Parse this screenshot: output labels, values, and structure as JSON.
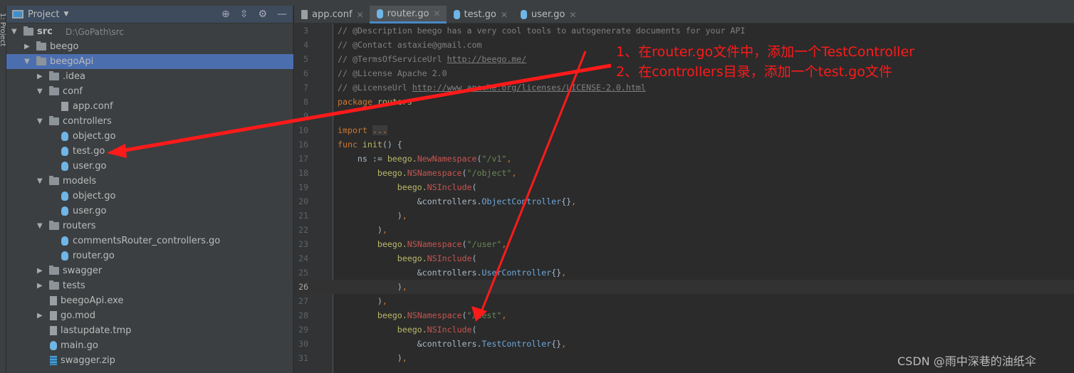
{
  "sidebar_stripe_label": "1: Project",
  "project_panel": {
    "title": "Project",
    "tools": [
      "locate-icon",
      "collapse-icon",
      "gear-icon",
      "minimize-icon"
    ],
    "tree": [
      {
        "label": "src",
        "path": "D:\\GoPath\\src",
        "level": 0,
        "type": "folder",
        "expanded": true
      },
      {
        "label": "beego",
        "level": 1,
        "type": "folder",
        "expanded": false
      },
      {
        "label": "beegoApi",
        "level": 1,
        "type": "folder",
        "expanded": true,
        "selected": true
      },
      {
        "label": ".idea",
        "level": 2,
        "type": "folder",
        "expanded": false
      },
      {
        "label": "conf",
        "level": 2,
        "type": "folder",
        "expanded": true
      },
      {
        "label": "app.conf",
        "level": 3,
        "type": "file"
      },
      {
        "label": "controllers",
        "level": 2,
        "type": "folder",
        "expanded": true
      },
      {
        "label": "object.go",
        "level": 3,
        "type": "go"
      },
      {
        "label": "test.go",
        "level": 3,
        "type": "go"
      },
      {
        "label": "user.go",
        "level": 3,
        "type": "go"
      },
      {
        "label": "models",
        "level": 2,
        "type": "folder",
        "expanded": true
      },
      {
        "label": "object.go",
        "level": 3,
        "type": "go"
      },
      {
        "label": "user.go",
        "level": 3,
        "type": "go"
      },
      {
        "label": "routers",
        "level": 2,
        "type": "folder",
        "expanded": true
      },
      {
        "label": "commentsRouter_controllers.go",
        "level": 3,
        "type": "go"
      },
      {
        "label": "router.go",
        "level": 3,
        "type": "go"
      },
      {
        "label": "swagger",
        "level": 2,
        "type": "folder",
        "expanded": false
      },
      {
        "label": "tests",
        "level": 2,
        "type": "folder",
        "expanded": false
      },
      {
        "label": "beegoApi.exe",
        "level": 2,
        "type": "file"
      },
      {
        "label": "go.mod",
        "level": 2,
        "type": "file",
        "expandable": true
      },
      {
        "label": "lastupdate.tmp",
        "level": 2,
        "type": "file"
      },
      {
        "label": "main.go",
        "level": 2,
        "type": "go"
      },
      {
        "label": "swagger.zip",
        "level": 2,
        "type": "zip"
      }
    ]
  },
  "editor": {
    "tabs": [
      {
        "label": "app.conf",
        "icon": "conf"
      },
      {
        "label": "router.go",
        "icon": "go",
        "active": true
      },
      {
        "label": "test.go",
        "icon": "go"
      },
      {
        "label": "user.go",
        "icon": "go"
      }
    ],
    "current_line": 26,
    "lines": [
      {
        "n": 3,
        "t": [
          [
            "c",
            "// @Description beego has a very cool tools to autogenerate documents for your API"
          ]
        ]
      },
      {
        "n": 4,
        "t": [
          [
            "c",
            "// @Contact astaxie@gmail.com"
          ]
        ]
      },
      {
        "n": 5,
        "t": [
          [
            "c",
            "// @TermsOfServiceUrl "
          ],
          [
            "u",
            "http://beego.me/"
          ]
        ]
      },
      {
        "n": 6,
        "t": [
          [
            "c",
            "// @License Apache 2.0"
          ]
        ]
      },
      {
        "n": 7,
        "t": [
          [
            "c",
            "// @LicenseUrl "
          ],
          [
            "u",
            "http://www.apache.org/licenses/LICENSE-2.0.html"
          ]
        ]
      },
      {
        "n": 8,
        "t": [
          [
            "k",
            "package "
          ],
          [
            "p",
            "routers"
          ]
        ]
      },
      {
        "n": 9,
        "t": []
      },
      {
        "n": 10,
        "t": [
          [
            "k",
            "import "
          ],
          [
            "fold",
            "..."
          ]
        ]
      },
      {
        "n": 16,
        "t": [
          [
            "k",
            "func "
          ],
          [
            "p",
            "init"
          ],
          [
            "",
            "() {"
          ]
        ]
      },
      {
        "n": 17,
        "t": [
          [
            "",
            "    ns := "
          ],
          [
            "p",
            "beego."
          ],
          [
            "f",
            "NewNamespace"
          ],
          [
            "",
            "("
          ],
          [
            "s",
            "\"/v1\""
          ],
          [
            "d",
            ","
          ]
        ]
      },
      {
        "n": 18,
        "t": [
          [
            "",
            "        "
          ],
          [
            "p",
            "beego."
          ],
          [
            "f",
            "NSNamespace"
          ],
          [
            "",
            "("
          ],
          [
            "s",
            "\"/object\""
          ],
          [
            "d",
            ","
          ]
        ]
      },
      {
        "n": 19,
        "t": [
          [
            "",
            "            "
          ],
          [
            "p",
            "beego."
          ],
          [
            "f",
            "NSInclude"
          ],
          [
            "",
            "("
          ]
        ]
      },
      {
        "n": 20,
        "t": [
          [
            "",
            "                &controllers."
          ],
          [
            "ty",
            "ObjectController"
          ],
          [
            "",
            "{}"
          ],
          [
            "d",
            ","
          ]
        ]
      },
      {
        "n": 21,
        "t": [
          [
            "",
            "            )"
          ],
          [
            "d",
            ","
          ]
        ]
      },
      {
        "n": 22,
        "t": [
          [
            "",
            "        )"
          ],
          [
            "d",
            ","
          ]
        ]
      },
      {
        "n": 23,
        "t": [
          [
            "",
            "        "
          ],
          [
            "p",
            "beego."
          ],
          [
            "f",
            "NSNamespace"
          ],
          [
            "",
            "("
          ],
          [
            "s",
            "\"/user\""
          ],
          [
            "d",
            ","
          ]
        ]
      },
      {
        "n": 24,
        "t": [
          [
            "",
            "            "
          ],
          [
            "p",
            "beego."
          ],
          [
            "f",
            "NSInclude"
          ],
          [
            "",
            "("
          ]
        ]
      },
      {
        "n": 25,
        "t": [
          [
            "",
            "                &controllers."
          ],
          [
            "ty",
            "UserController"
          ],
          [
            "",
            "{}"
          ],
          [
            "d",
            ","
          ]
        ]
      },
      {
        "n": 26,
        "t": [
          [
            "",
            "            )"
          ],
          [
            "d",
            ","
          ]
        ]
      },
      {
        "n": 27,
        "t": [
          [
            "",
            "        )"
          ],
          [
            "d",
            ","
          ]
        ]
      },
      {
        "n": 28,
        "t": [
          [
            "",
            "        "
          ],
          [
            "p",
            "beego."
          ],
          [
            "f",
            "NSNamespace"
          ],
          [
            "",
            "("
          ],
          [
            "s",
            "\"/test\""
          ],
          [
            "d",
            ","
          ]
        ]
      },
      {
        "n": 29,
        "t": [
          [
            "",
            "            "
          ],
          [
            "p",
            "beego."
          ],
          [
            "f",
            "NSInclude"
          ],
          [
            "",
            "("
          ]
        ]
      },
      {
        "n": 30,
        "t": [
          [
            "",
            "                &controllers."
          ],
          [
            "ty",
            "TestController"
          ],
          [
            "",
            "{}"
          ],
          [
            "d",
            ","
          ]
        ]
      },
      {
        "n": 31,
        "t": [
          [
            "",
            "            )"
          ],
          [
            "d",
            ","
          ]
        ]
      }
    ]
  },
  "annotations": {
    "note1": "1、在router.go文件中，添加一个TestController",
    "note2": "2、在controllers目录，添加一个test.go文件",
    "color": "#ff1a1a"
  },
  "watermark": "CSDN @雨中深巷的油纸伞"
}
